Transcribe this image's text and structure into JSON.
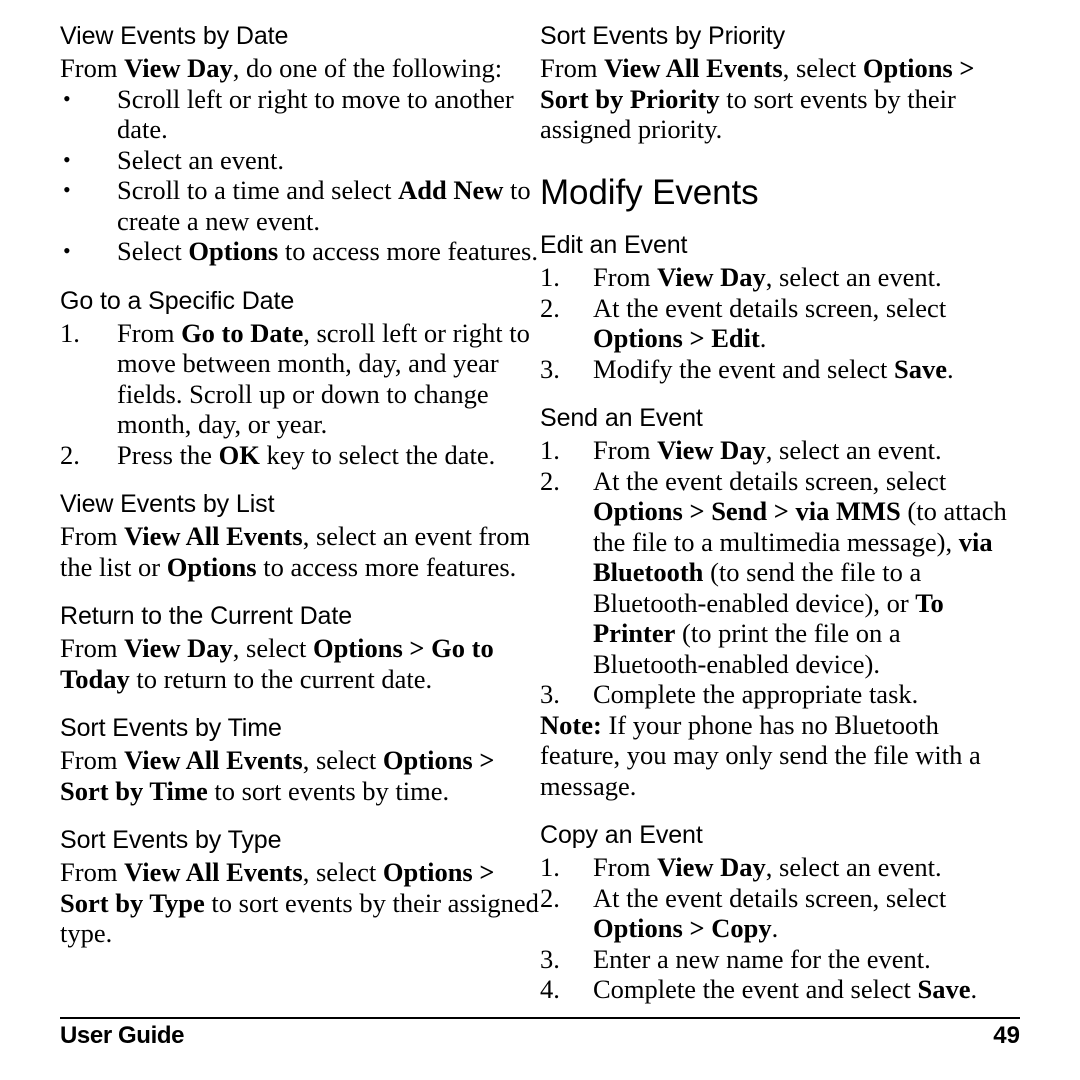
{
  "document": {
    "footer_label": "User Guide",
    "page_number": "49"
  },
  "left_column": {
    "s1": {
      "heading": "View Events by Date",
      "intro_a": "From ",
      "intro_b": "View Day",
      "intro_c": ", do one of the following:",
      "bullet_marker": "•",
      "b1": "Scroll left or right to move to another date.",
      "b2": "Select an event.",
      "b3_a": "Scroll to a time and select ",
      "b3_b": "Add New",
      "b3_c": " to create a new event.",
      "b4_a": "Select ",
      "b4_b": "Options",
      "b4_c": " to access more features."
    },
    "s2": {
      "heading": "Go to a Specific Date",
      "n1": "1.",
      "i1_a": "From ",
      "i1_b": "Go to Date",
      "i1_c": ", scroll left or right to move between month, day, and year fields. Scroll up or down to change month, day, or year.",
      "n2": "2.",
      "i2_a": "Press the ",
      "i2_b": "OK",
      "i2_c": " key to select the date."
    },
    "s3": {
      "heading": "View Events by List",
      "p_a": "From ",
      "p_b": "View All Events",
      "p_c": ", select an event from the list or ",
      "p_d": "Options",
      "p_e": " to access more features."
    },
    "s4": {
      "heading": "Return to the Current Date",
      "p_a": "From ",
      "p_b": "View Day",
      "p_c": ", select ",
      "p_d": "Options > Go to Today",
      "p_e": " to return to the current date."
    },
    "s5": {
      "heading": "Sort Events by Time",
      "p_a": "From ",
      "p_b": "View All Events",
      "p_c": ", select ",
      "p_d": "Options > Sort by Time",
      "p_e": " to sort events by time."
    },
    "s6": {
      "heading": "Sort Events by Type",
      "p_a": "From ",
      "p_b": "View All Events",
      "p_c": ", select ",
      "p_d": "Options > Sort by Type",
      "p_e": " to sort events by their assigned type."
    }
  },
  "right_column": {
    "s1": {
      "heading": "Sort Events by Priority",
      "p_a": "From ",
      "p_b": "View All Events",
      "p_c": ", select ",
      "p_d": "Options > Sort by Priority",
      "p_e": " to sort events by their assigned priority."
    },
    "chapter": "Modify Events",
    "s2": {
      "heading": "Edit an Event",
      "n1": "1.",
      "i1_a": "From ",
      "i1_b": "View Day",
      "i1_c": ", select an event.",
      "n2": "2.",
      "i2_a": "At the event details screen, select ",
      "i2_b": "Options > Edit",
      "i2_c": ".",
      "n3": "3.",
      "i3_a": "Modify the event and select ",
      "i3_b": "Save",
      "i3_c": "."
    },
    "s3": {
      "heading": "Send an Event",
      "n1": "1.",
      "i1_a": "From ",
      "i1_b": "View Day",
      "i1_c": ", select an event.",
      "n2": "2.",
      "i2_a": "At the event details screen, select ",
      "i2_b": "Options > Send > via MMS",
      "i2_c": " (to attach the file to a multimedia message), ",
      "i2_d": "via Bluetooth",
      "i2_e": " (to send the file to a Bluetooth-enabled device), or ",
      "i2_f": "To Printer",
      "i2_g": " (to print the file on a Bluetooth-enabled device).",
      "n3": "3.",
      "i3": "Complete the appropriate task.",
      "note_label": "Note:",
      "note_text": " If your phone has no Bluetooth feature, you may only send the file with a message."
    },
    "s4": {
      "heading": "Copy an Event",
      "n1": "1.",
      "i1_a": "From ",
      "i1_b": "View Day",
      "i1_c": ", select an event.",
      "n2": "2.",
      "i2_a": "At the event details screen, select ",
      "i2_b": "Options > Copy",
      "i2_c": ".",
      "n3": "3.",
      "i3": "Enter a new name for the event.",
      "n4": "4.",
      "i4_a": "Complete the event and select ",
      "i4_b": "Save",
      "i4_c": "."
    }
  }
}
